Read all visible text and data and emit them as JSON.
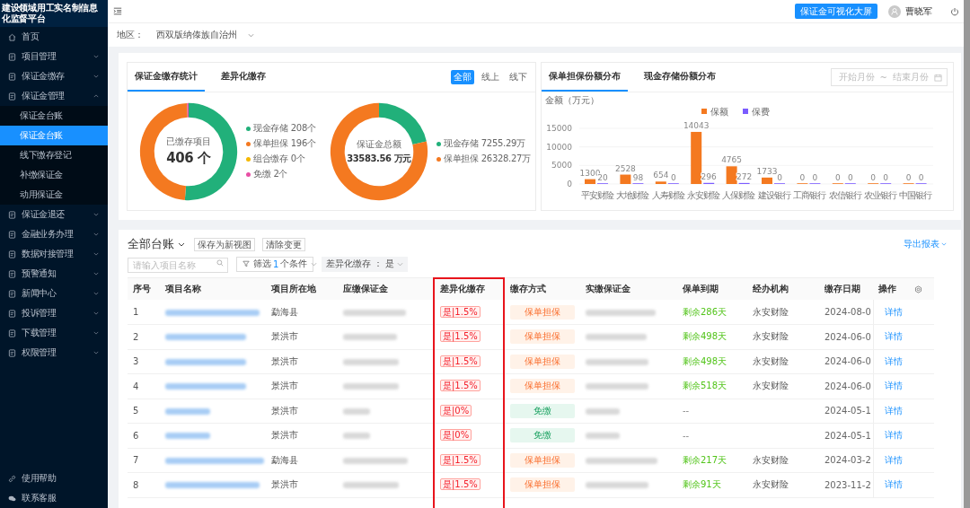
{
  "sidebar": {
    "title": "建设领域用工实名制信息化监督平台",
    "items": [
      {
        "label": "首页"
      },
      {
        "label": "项目管理",
        "expanded": false
      },
      {
        "label": "保证金缴存",
        "expanded": false
      },
      {
        "label": "保证金管理",
        "expanded": true,
        "children": [
          {
            "label": "保证金台账",
            "selected": false
          },
          {
            "label": "保证金台账",
            "selected": true
          },
          {
            "label": "线下缴存登记",
            "selected": false
          },
          {
            "label": "补缴保证金",
            "selected": false
          },
          {
            "label": "动用保证金",
            "selected": false
          }
        ]
      },
      {
        "label": "保证金退还",
        "expanded": false
      },
      {
        "label": "金融业务办理",
        "expanded": false
      },
      {
        "label": "数据对接管理",
        "expanded": false
      },
      {
        "label": "预警通知",
        "expanded": false
      },
      {
        "label": "新闻中心",
        "expanded": false
      },
      {
        "label": "投诉管理",
        "expanded": false
      },
      {
        "label": "下载管理",
        "expanded": false
      },
      {
        "label": "权限管理",
        "expanded": false
      }
    ],
    "footer": [
      "使用帮助",
      "联系客服"
    ]
  },
  "header": {
    "big_screen_button": "保证金可视化大屏",
    "user": "曹晓军"
  },
  "region": {
    "label": "地区：",
    "value": "西双版纳傣族自治州"
  },
  "stats": {
    "tabs": [
      {
        "label": "保证金缴存统计",
        "selected": true
      },
      {
        "label": "差异化缴存",
        "selected": false
      }
    ],
    "channels": [
      {
        "label": "全部",
        "selected": true
      },
      {
        "label": "线上",
        "selected": false
      },
      {
        "label": "线下",
        "selected": false
      }
    ],
    "donuts": [
      {
        "center_label": "已缴存项目",
        "center_value": "406 个",
        "big": true,
        "legend": [
          {
            "label": "现金存储",
            "value": "208个",
            "color": "#21b07a"
          },
          {
            "label": "保单担保",
            "value": "196个",
            "color": "#f47920"
          },
          {
            "label": "组合缴存",
            "value": "0个",
            "color": "#f5b800"
          },
          {
            "label": "免缴",
            "value": "2个",
            "color": "#e84fa5"
          }
        ]
      },
      {
        "center_label": "保证金总额",
        "center_value": "33583.56 万元",
        "big": false,
        "legend": [
          {
            "label": "现金存储",
            "value": "7255.29万",
            "color": "#21b07a"
          },
          {
            "label": "保单担保",
            "value": "26328.27万",
            "color": "#f47920"
          }
        ]
      }
    ]
  },
  "distribution": {
    "tabs": [
      {
        "label": "保单担保份额分布",
        "selected": true
      },
      {
        "label": "现金存储份额分布",
        "selected": false
      }
    ],
    "date_range": {
      "start_placeholder": "开始月份",
      "separator": "~",
      "end_placeholder": "结束月份"
    },
    "chart_data": {
      "type": "bar",
      "ylabel": "金额（万元）",
      "legend": "top",
      "categories": [
        "平安财险",
        "大地财险",
        "人寿财险",
        "永安财险",
        "人保财险",
        "建设银行",
        "工商银行",
        "农信银行",
        "农业银行",
        "中国银行"
      ],
      "series": [
        {
          "name": "保额",
          "color": "#f47920",
          "values": [
            1300,
            2528,
            654,
            14043,
            4765,
            1733,
            0,
            0,
            0,
            0
          ]
        },
        {
          "name": "保费",
          "color": "#7b5cff",
          "values": [
            20,
            98,
            0,
            296,
            272,
            0,
            0,
            0,
            0,
            0
          ]
        }
      ],
      "ylim": [
        0,
        15000
      ],
      "yticks": [
        0,
        5000,
        10000,
        15000
      ],
      "data_labels": true
    }
  },
  "ledger": {
    "title": "全部台账",
    "buttons": [
      "保存为新视图",
      "清除变更"
    ],
    "export": "导出报表",
    "search": {
      "placeholder": "请输入项目名称"
    },
    "filter": {
      "prefix": "筛选",
      "count": "1",
      "suffix": "个条件"
    },
    "filter_tag": {
      "label": "差异化缴存",
      "separator": "：",
      "value": "是"
    },
    "columns": [
      "序号",
      "项目名称",
      "项目所在地",
      "应缴保证金",
      "差异化缴存",
      "缴存方式",
      "实缴保证金",
      "保单到期",
      "经办机构",
      "缴存日期",
      "操作"
    ],
    "rows": [
      {
        "index": "1",
        "location": "勐海县",
        "diff": "是|1.5%",
        "method": {
          "kind": "policy",
          "label": "保单担保"
        },
        "expiry": "剩余286天",
        "agency": "永安财险",
        "date": "2024-08-0",
        "action": "详情"
      },
      {
        "index": "2",
        "location": "景洪市",
        "diff": "是|1.5%",
        "method": {
          "kind": "policy",
          "label": "保单担保"
        },
        "expiry": "剩余498天",
        "agency": "永安财险",
        "date": "2024-06-0",
        "action": "详情"
      },
      {
        "index": "3",
        "location": "景洪市",
        "diff": "是|1.5%",
        "method": {
          "kind": "policy",
          "label": "保单担保"
        },
        "expiry": "剩余498天",
        "agency": "永安财险",
        "date": "2024-06-0",
        "action": "详情"
      },
      {
        "index": "4",
        "location": "景洪市",
        "diff": "是|1.5%",
        "method": {
          "kind": "policy",
          "label": "保单担保"
        },
        "expiry": "剩余518天",
        "agency": "永安财险",
        "date": "2024-06-0",
        "action": "详情"
      },
      {
        "index": "5",
        "location": "景洪市",
        "diff": "是|0%",
        "method": {
          "kind": "exempt",
          "label": "免缴"
        },
        "expiry": "--",
        "date": "2024-05-1",
        "action": "详情"
      },
      {
        "index": "6",
        "location": "景洪市",
        "diff": "是|0%",
        "method": {
          "kind": "exempt",
          "label": "免缴"
        },
        "expiry": "--",
        "date": "2024-05-1",
        "action": "详情"
      },
      {
        "index": "7",
        "location": "勐海县",
        "diff": "是|1.5%",
        "method": {
          "kind": "policy",
          "label": "保单担保"
        },
        "expiry": "剩余217天",
        "agency": "永安财险",
        "date": "2024-03-2",
        "action": "详情"
      },
      {
        "index": "8",
        "location": "景洪市",
        "diff": "是|1.5%",
        "method": {
          "kind": "policy",
          "label": "保单担保"
        },
        "expiry": "剩余91天",
        "agency": "永安财险",
        "date": "2023-11-2",
        "action": "详情"
      }
    ]
  }
}
